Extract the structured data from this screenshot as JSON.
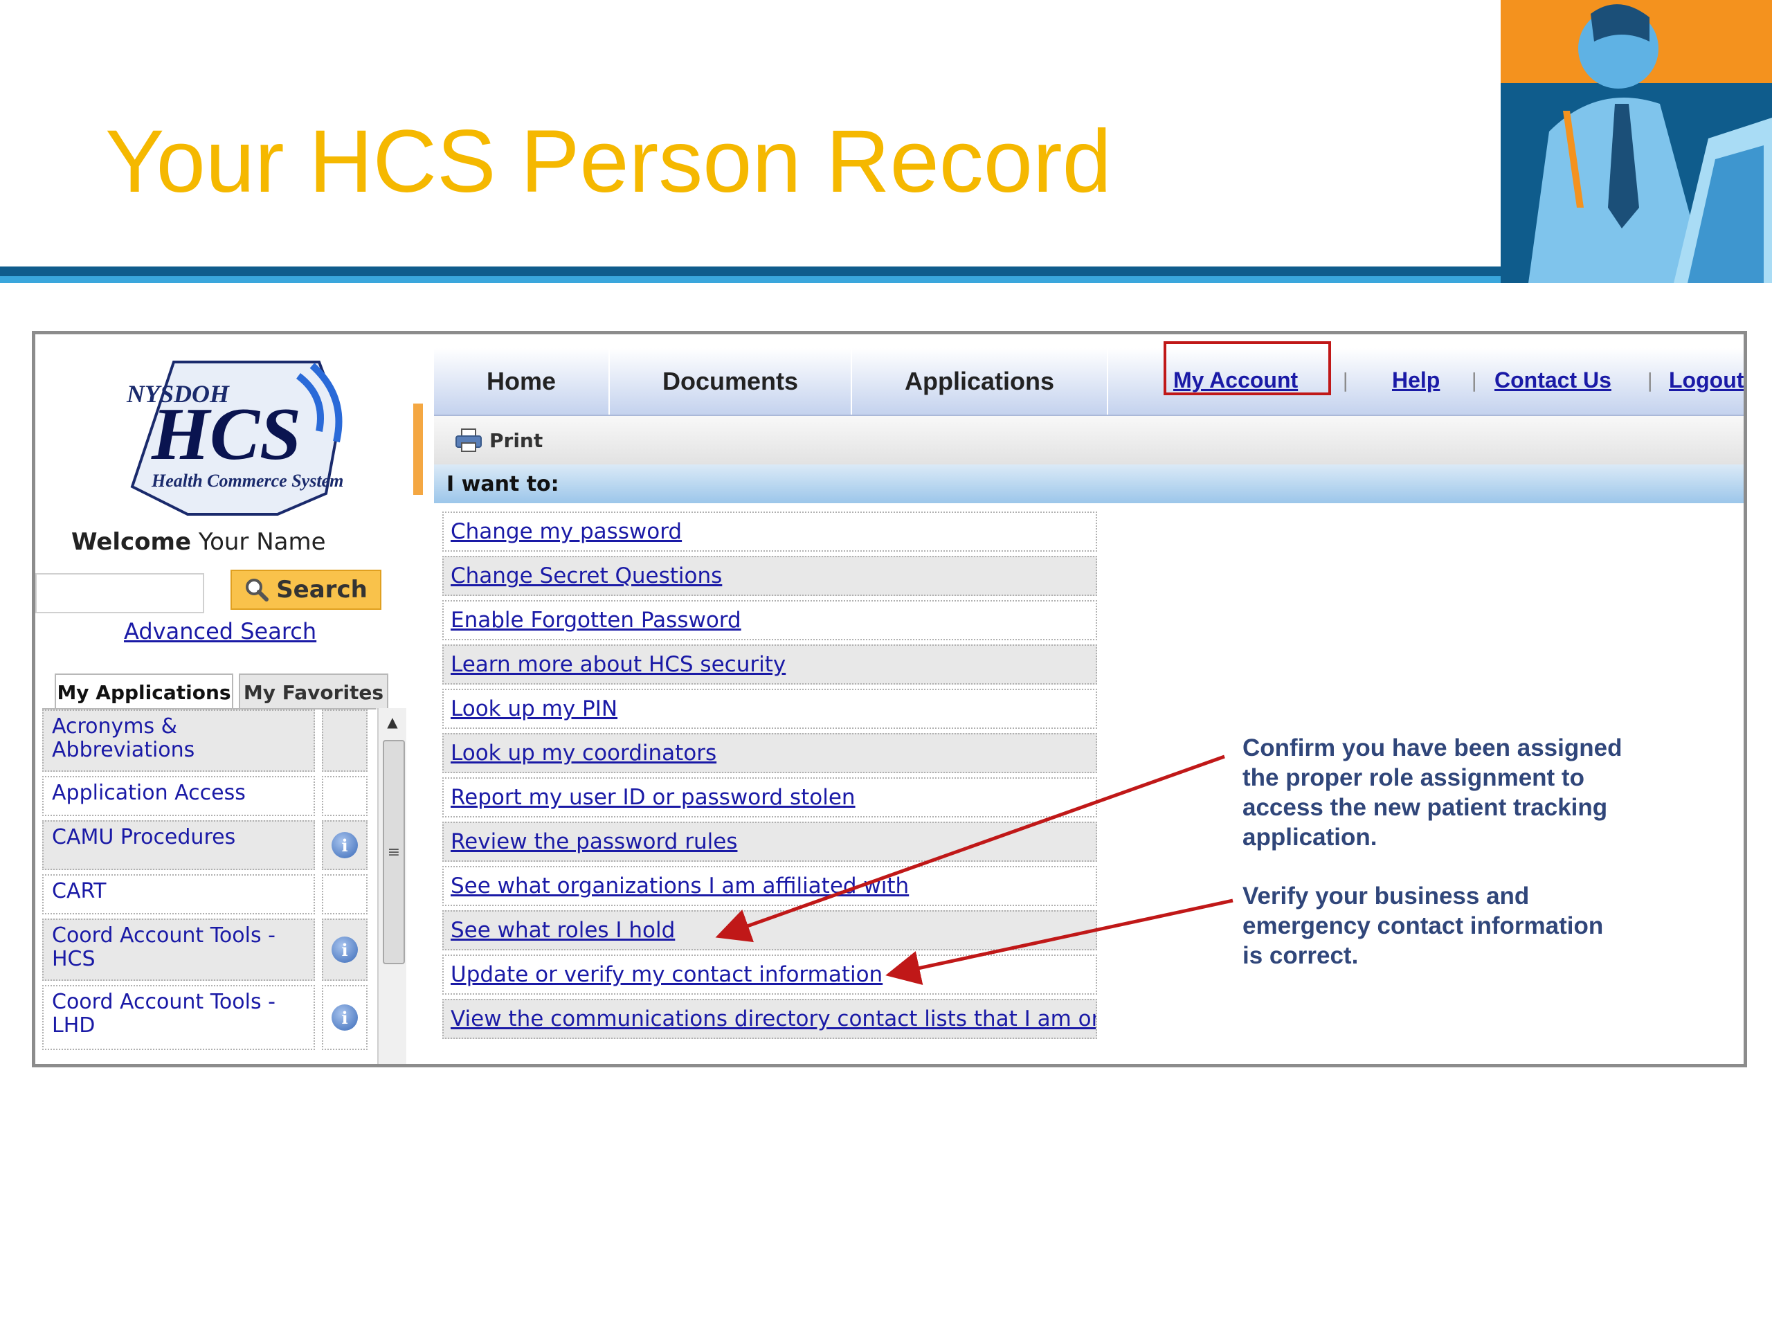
{
  "slide": {
    "title": "Your HCS Person Record",
    "colors": {
      "title": "#f5b800",
      "rule_dark": "#0f5c8c",
      "rule_light": "#3aa6dc",
      "accent_orange": "#f4921e"
    }
  },
  "logo": {
    "org": "NYSDOH",
    "acronym": "HCS",
    "tagline": "Health Commerce System"
  },
  "welcome": {
    "prefix": "Welcome",
    "name": "Your Name"
  },
  "search": {
    "input_value": "",
    "button_label": "Search",
    "advanced_label": "Advanced Search",
    "icon": "magnifier-icon"
  },
  "tabs": [
    {
      "label": "My Applications",
      "active": true
    },
    {
      "label": "My Favorites",
      "active": false
    }
  ],
  "applications": [
    {
      "label": "Acronyms & Abbreviations",
      "info": false
    },
    {
      "label": "Application Access",
      "info": false
    },
    {
      "label": "CAMU Procedures",
      "info": true
    },
    {
      "label": "CART",
      "info": false
    },
    {
      "label": "Coord Account Tools - HCS",
      "info": true
    },
    {
      "label": "Coord Account Tools - LHD",
      "info": true
    }
  ],
  "nav": {
    "items": [
      "Home",
      "Documents",
      "Applications"
    ],
    "utility": [
      "My Account",
      "Help",
      "Contact Us",
      "Logout"
    ],
    "highlight_color": "#c01818"
  },
  "toolbar": {
    "print_label": "Print"
  },
  "section": {
    "heading": "I want to:"
  },
  "links": [
    "Change my password",
    "Change Secret Questions",
    "Enable Forgotten Password",
    "Learn more about HCS security",
    "Look up my PIN",
    "Look up my coordinators",
    "Report my user ID or password stolen",
    "Review the password rules",
    "See what organizations I am affiliated with",
    "See what roles I hold",
    "Update or verify my contact information",
    "View the communications directory contact lists that I am on"
  ],
  "callouts": [
    {
      "lines": [
        "Confirm you have been assigned",
        "the proper role assignment to",
        "access the new patient tracking",
        "application."
      ],
      "points_to": "See what roles I hold"
    },
    {
      "lines": [
        "Verify your business and",
        "emergency contact information",
        "is correct."
      ],
      "points_to": "Update or verify my contact information"
    }
  ],
  "annotation_color": "#c01818"
}
